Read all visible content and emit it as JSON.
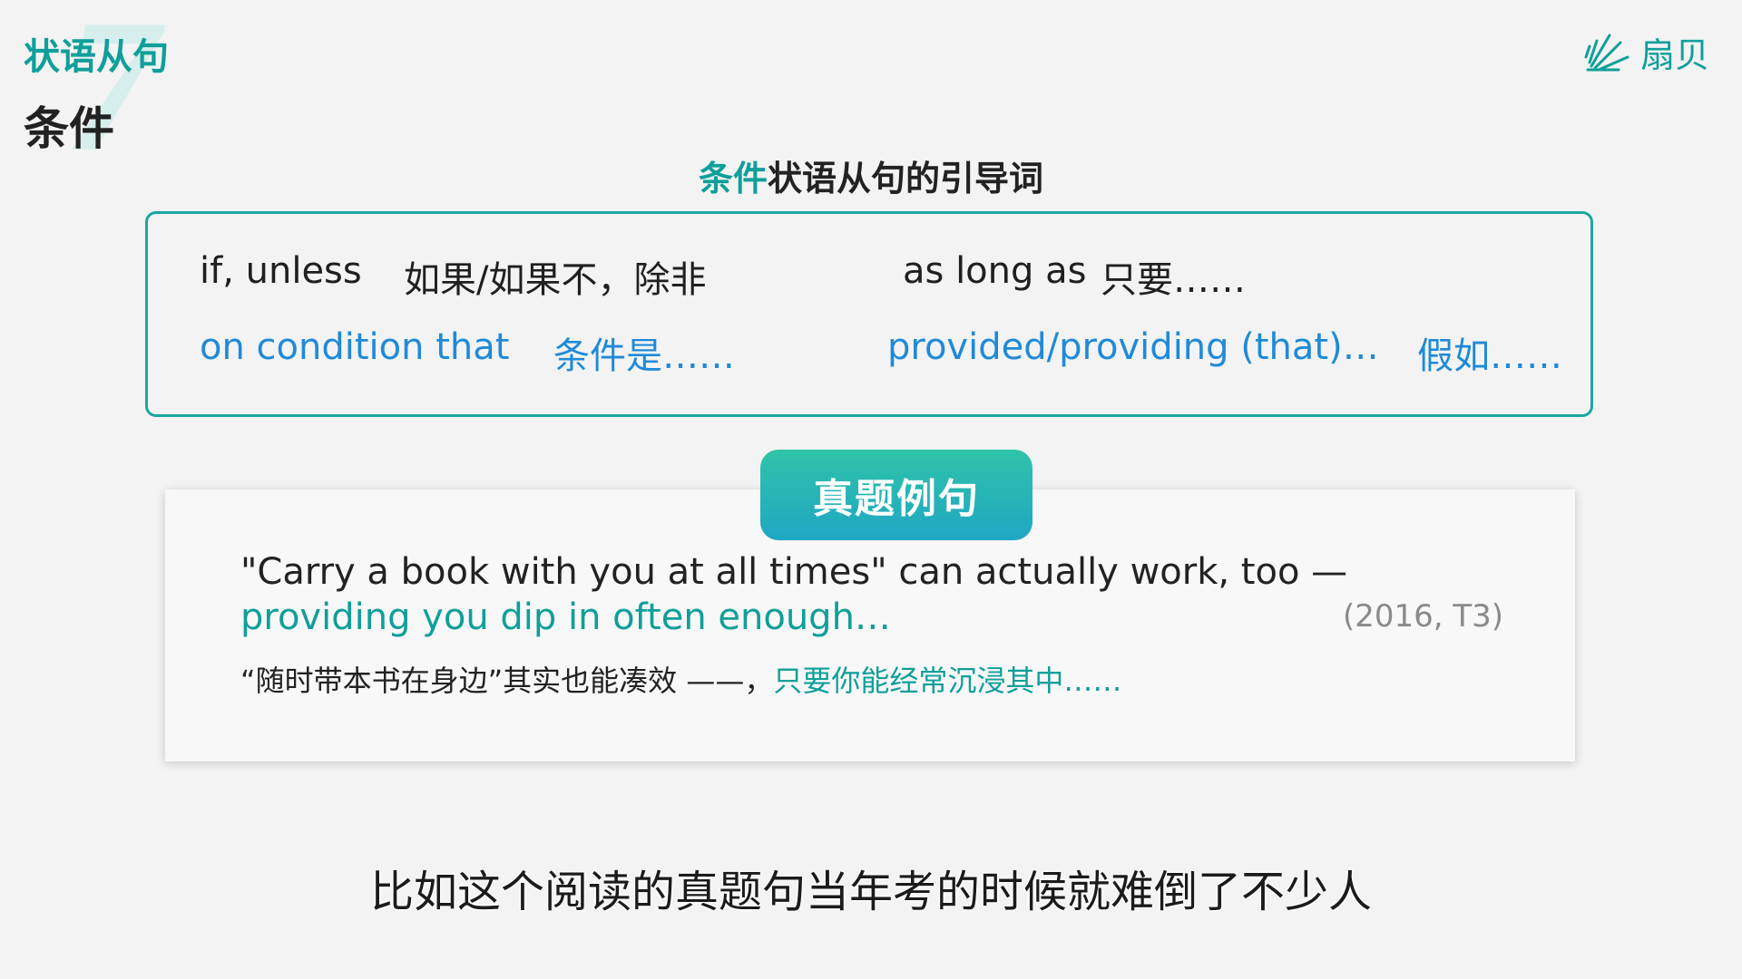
{
  "header": {
    "number": "7",
    "section_title": "状语从句",
    "sub_title": "条件"
  },
  "logo": {
    "text": "扇贝"
  },
  "intro": {
    "heading_accent": "条件",
    "heading_rest": "状语从句的引导词"
  },
  "conjunctions": [
    {
      "en": "if, unless",
      "zh": "如果/如果不，除非",
      "color": "#1f1f1f"
    },
    {
      "en": "as long as",
      "zh": "只要……",
      "color": "#1f1f1f"
    },
    {
      "en": "on condition that",
      "zh": "条件是……",
      "color": "#1f8ad8"
    },
    {
      "en": "provided/providing  (that)…",
      "zh": "假如……",
      "color": "#1f8ad8"
    }
  ],
  "example": {
    "tag": "真题例句",
    "sentence_plain": "\"Carry a book with you at all times\" can actually work, too — ",
    "sentence_highlight": "providing you dip in often enough…",
    "source": "(2016, T3)",
    "translation_plain": "“随时带本书在身边”其实也能凑效 ——，",
    "translation_highlight": "只要你能经常沉浸其中……"
  },
  "subtitle": "比如这个阅读的真题句当年考的时候就难倒了不少人",
  "colors": {
    "accent": "#0f9f9a",
    "blue": "#1f8ad8",
    "border": "#1aa79f"
  },
  "icons": [
    "shanbay-logo-icon"
  ]
}
